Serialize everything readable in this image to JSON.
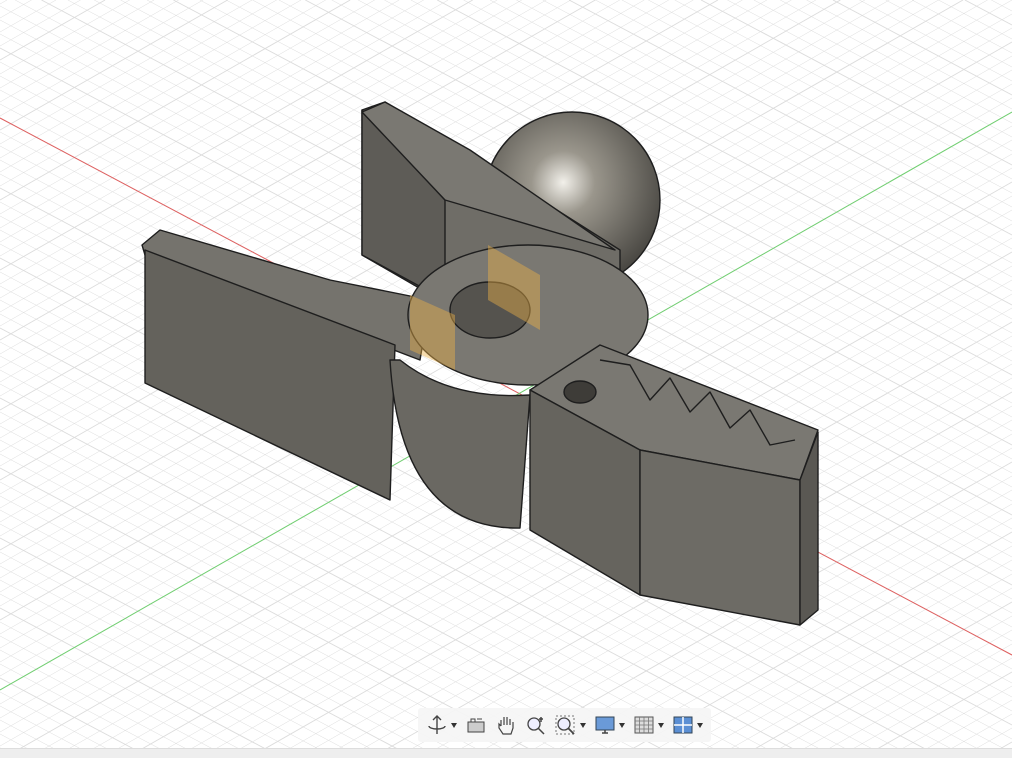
{
  "viewport": {
    "background": "#ffffff",
    "grid_color": "#dcdcdc",
    "x_axis_color": "#e06060",
    "y_axis_color": "#70d070",
    "model_color": "#6e6c66",
    "highlight_color": "#e8b04a"
  },
  "toolbar": {
    "items": [
      {
        "icon": "orbit-icon",
        "has_dropdown": true
      },
      {
        "icon": "look-at-icon",
        "has_dropdown": false
      },
      {
        "icon": "pan-hand-icon",
        "has_dropdown": false
      },
      {
        "icon": "zoom-icon",
        "has_dropdown": false
      },
      {
        "icon": "fit-window-icon",
        "has_dropdown": true
      },
      {
        "icon": "display-settings-icon",
        "has_dropdown": true
      },
      {
        "icon": "grid-snaps-icon",
        "has_dropdown": true
      },
      {
        "icon": "viewports-icon",
        "has_dropdown": true
      }
    ]
  }
}
